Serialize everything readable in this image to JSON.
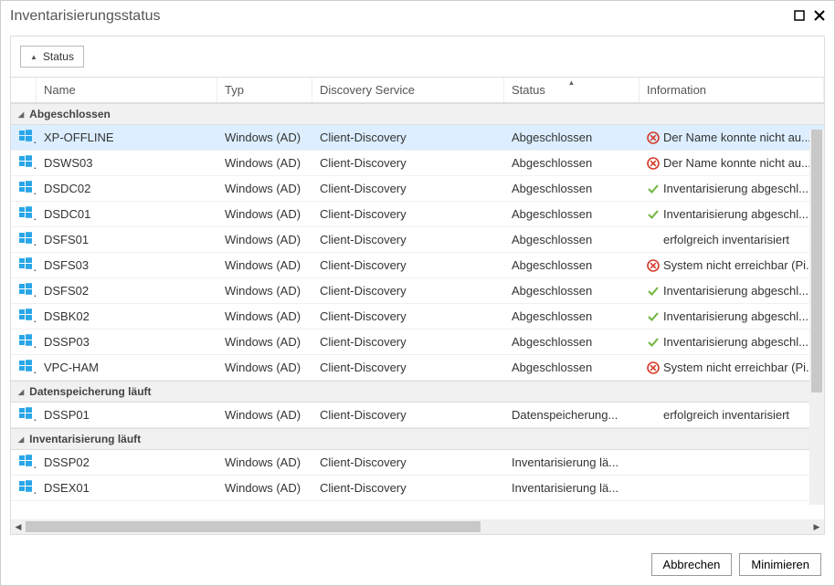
{
  "window": {
    "title": "Inventarisierungsstatus"
  },
  "group_chip": {
    "label": "Status"
  },
  "columns": {
    "name": "Name",
    "typ": "Typ",
    "discovery": "Discovery Service",
    "status": "Status",
    "info": "Information"
  },
  "groups": [
    {
      "label": "Abgeschlossen",
      "rows": [
        {
          "name": "XP-OFFLINE",
          "typ": "Windows (AD)",
          "discovery": "Client-Discovery",
          "status": "Abgeschlossen",
          "info_icon": "error",
          "info": "Der Name konnte nicht au...",
          "selected": true
        },
        {
          "name": "DSWS03",
          "typ": "Windows (AD)",
          "discovery": "Client-Discovery",
          "status": "Abgeschlossen",
          "info_icon": "error",
          "info": "Der Name konnte nicht au..."
        },
        {
          "name": "DSDC02",
          "typ": "Windows (AD)",
          "discovery": "Client-Discovery",
          "status": "Abgeschlossen",
          "info_icon": "ok",
          "info": "Inventarisierung abgeschl..."
        },
        {
          "name": "DSDC01",
          "typ": "Windows (AD)",
          "discovery": "Client-Discovery",
          "status": "Abgeschlossen",
          "info_icon": "ok",
          "info": "Inventarisierung abgeschl..."
        },
        {
          "name": "DSFS01",
          "typ": "Windows (AD)",
          "discovery": "Client-Discovery",
          "status": "Abgeschlossen",
          "info_icon": "none",
          "info": "erfolgreich inventarisiert"
        },
        {
          "name": "DSFS03",
          "typ": "Windows (AD)",
          "discovery": "Client-Discovery",
          "status": "Abgeschlossen",
          "info_icon": "error",
          "info": "System nicht erreichbar (Pi..."
        },
        {
          "name": "DSFS02",
          "typ": "Windows (AD)",
          "discovery": "Client-Discovery",
          "status": "Abgeschlossen",
          "info_icon": "ok",
          "info": "Inventarisierung abgeschl..."
        },
        {
          "name": "DSBK02",
          "typ": "Windows (AD)",
          "discovery": "Client-Discovery",
          "status": "Abgeschlossen",
          "info_icon": "ok",
          "info": "Inventarisierung abgeschl..."
        },
        {
          "name": "DSSP03",
          "typ": "Windows (AD)",
          "discovery": "Client-Discovery",
          "status": "Abgeschlossen",
          "info_icon": "ok",
          "info": "Inventarisierung abgeschl..."
        },
        {
          "name": "VPC-HAM",
          "typ": "Windows (AD)",
          "discovery": "Client-Discovery",
          "status": "Abgeschlossen",
          "info_icon": "error",
          "info": "System nicht erreichbar (Pi..."
        }
      ]
    },
    {
      "label": "Datenspeicherung läuft",
      "rows": [
        {
          "name": "DSSP01",
          "typ": "Windows (AD)",
          "discovery": "Client-Discovery",
          "status": "Datenspeicherung...",
          "info_icon": "none",
          "info": "erfolgreich inventarisiert"
        }
      ]
    },
    {
      "label": "Inventarisierung läuft",
      "rows": [
        {
          "name": "DSSP02",
          "typ": "Windows (AD)",
          "discovery": "Client-Discovery",
          "status": "Inventarisierung lä...",
          "info_icon": "none",
          "info": ""
        },
        {
          "name": "DSEX01",
          "typ": "Windows (AD)",
          "discovery": "Client-Discovery",
          "status": "Inventarisierung lä...",
          "info_icon": "none",
          "info": ""
        }
      ]
    }
  ],
  "footer": {
    "cancel": "Abbrechen",
    "minimize": "Minimieren"
  }
}
